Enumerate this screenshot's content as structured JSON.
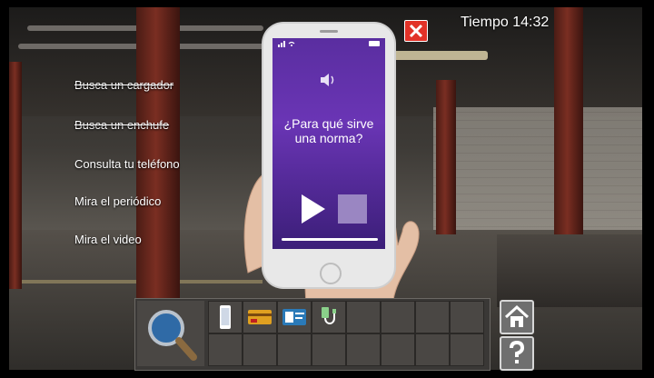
{
  "hud": {
    "timer_label": "Tiempo 14:32"
  },
  "objectives": [
    {
      "label": "Busca un cargador",
      "completed": true
    },
    {
      "label": "Busca un enchufe",
      "completed": true
    },
    {
      "label": "Consulta tu teléfono",
      "completed": false
    },
    {
      "label": "Mira el periódico",
      "completed": false
    },
    {
      "label": "Mira el video",
      "completed": false
    }
  ],
  "phone": {
    "question": "¿Para qué sirve una norma?",
    "icons": [
      "speaker-icon",
      "play-icon",
      "stop-icon"
    ]
  },
  "inventory": {
    "items": [
      "phone-icon",
      "card-icon",
      "ticket-icon",
      "charger-icon"
    ],
    "tools": [
      "magnifier-icon"
    ],
    "buttons": [
      "home-icon",
      "help-icon"
    ]
  },
  "colors": {
    "close_button": "#e23228",
    "phone_screen": "#5a2ea0"
  }
}
